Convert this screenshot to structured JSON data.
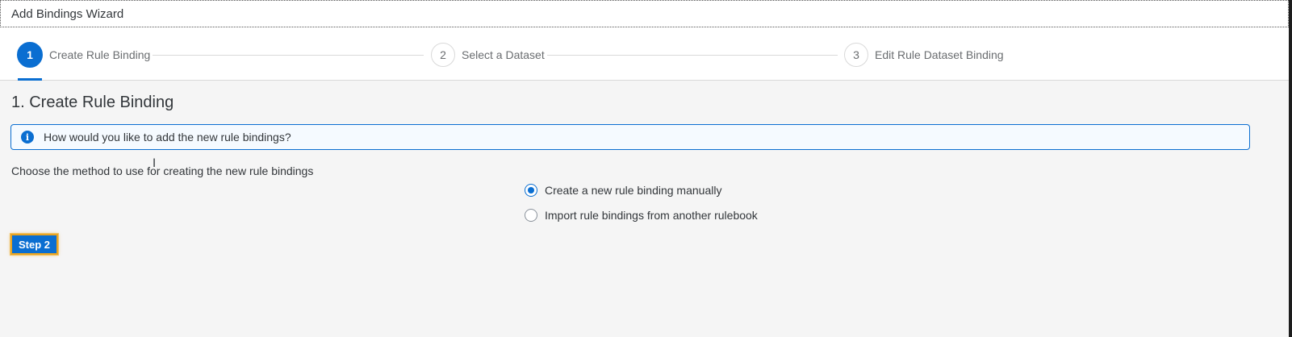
{
  "window": {
    "title": "Add Bindings Wizard"
  },
  "wizard": {
    "steps": [
      {
        "number": "1",
        "label": "Create Rule Binding",
        "active": true
      },
      {
        "number": "2",
        "label": "Select a Dataset",
        "active": false
      },
      {
        "number": "3",
        "label": "Edit Rule Dataset Binding",
        "active": false
      }
    ]
  },
  "content": {
    "heading": "1. Create Rule Binding",
    "info_message": "How would you like to add the new rule bindings?",
    "info_icon": "info-icon",
    "method_label": "Choose the method to use for creating the new rule bindings",
    "options": [
      {
        "label": "Create a new rule binding manually",
        "selected": true
      },
      {
        "label": "Import rule bindings from another rulebook",
        "selected": false
      }
    ],
    "next_button": "Step 2"
  },
  "colors": {
    "accent": "#0a6ed1",
    "focus_outline": "#e9a422",
    "background": "#f5f5f5"
  }
}
